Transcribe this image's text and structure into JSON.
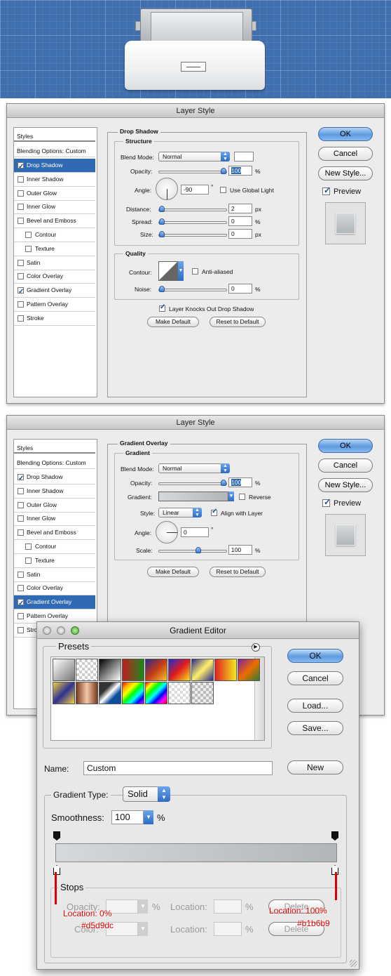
{
  "drop_shadow_dialog": {
    "title": "Layer Style",
    "styles_heading": "Styles",
    "blending_options": "Blending Options: Custom",
    "list": [
      {
        "label": "Drop Shadow",
        "checked": true,
        "selected": true
      },
      {
        "label": "Inner Shadow",
        "checked": false
      },
      {
        "label": "Outer Glow",
        "checked": false
      },
      {
        "label": "Inner Glow",
        "checked": false
      },
      {
        "label": "Bevel and Emboss",
        "checked": false
      },
      {
        "label": "Contour",
        "checked": false,
        "sub": true
      },
      {
        "label": "Texture",
        "checked": false,
        "sub": true
      },
      {
        "label": "Satin",
        "checked": false
      },
      {
        "label": "Color Overlay",
        "checked": false
      },
      {
        "label": "Gradient Overlay",
        "checked": true
      },
      {
        "label": "Pattern Overlay",
        "checked": false
      },
      {
        "label": "Stroke",
        "checked": false
      }
    ],
    "section_title": "Drop Shadow",
    "structure_title": "Structure",
    "blend_mode_label": "Blend Mode:",
    "blend_mode_value": "Normal",
    "opacity_label": "Opacity:",
    "opacity_value": "100",
    "angle_label": "Angle:",
    "angle_value": "-90",
    "degree": "°",
    "global_light_label": "Use Global Light",
    "distance_label": "Distance:",
    "distance_value": "2",
    "spread_label": "Spread:",
    "spread_value": "0",
    "size_label": "Size:",
    "size_value": "0",
    "quality_title": "Quality",
    "contour_label": "Contour:",
    "anti_aliased_label": "Anti-aliased",
    "noise_label": "Noise:",
    "noise_value": "0",
    "knocks_out_label": "Layer Knocks Out Drop Shadow",
    "make_default": "Make Default",
    "reset_default": "Reset to Default",
    "unit_pct": "%",
    "unit_px": "px",
    "ok": "OK",
    "cancel": "Cancel",
    "new_style": "New Style...",
    "preview": "Preview"
  },
  "gradient_overlay_dialog": {
    "title": "Layer Style",
    "styles_heading": "Styles",
    "blending_options": "Blending Options: Custom",
    "list": [
      {
        "label": "Drop Shadow",
        "checked": true
      },
      {
        "label": "Inner Shadow",
        "checked": false
      },
      {
        "label": "Outer Glow",
        "checked": false
      },
      {
        "label": "Inner Glow",
        "checked": false
      },
      {
        "label": "Bevel and Emboss",
        "checked": false
      },
      {
        "label": "Contour",
        "checked": false,
        "sub": true
      },
      {
        "label": "Texture",
        "checked": false,
        "sub": true
      },
      {
        "label": "Satin",
        "checked": false
      },
      {
        "label": "Color Overlay",
        "checked": false
      },
      {
        "label": "Gradient Overlay",
        "checked": true,
        "selected": true
      },
      {
        "label": "Pattern Overlay",
        "checked": false
      },
      {
        "label": "Stro",
        "checked": false
      }
    ],
    "section_title": "Gradient Overlay",
    "gradient_title": "Gradient",
    "blend_mode_label": "Blend Mode:",
    "blend_mode_value": "Normal",
    "opacity_label": "Opacity:",
    "opacity_value": "100",
    "gradient_label": "Gradient:",
    "reverse_label": "Reverse",
    "style_label": "Style:",
    "style_value": "Linear",
    "align_label": "Align with Layer",
    "angle_label": "Angle:",
    "angle_value": "0",
    "degree": "°",
    "scale_label": "Scale:",
    "scale_value": "100",
    "make_default": "Make Default",
    "reset_default": "Reset to Default",
    "unit_pct": "%",
    "ok": "OK",
    "cancel": "Cancel",
    "new_style": "New Style...",
    "preview": "Preview"
  },
  "gradient_editor": {
    "title": "Gradient Editor",
    "presets_label": "Presets",
    "ok": "OK",
    "cancel": "Cancel",
    "load": "Load...",
    "save": "Save...",
    "name_label": "Name:",
    "name_value": "Custom",
    "new": "New",
    "gradient_type_label": "Gradient Type:",
    "gradient_type_value": "Solid",
    "smoothness_label": "Smoothness:",
    "smoothness_value": "100",
    "unit_pct": "%",
    "stops_label": "Stops",
    "opacity_label": "Opacity:",
    "color_label": "Color:",
    "location_label": "Location:",
    "delete": "Delete",
    "annotation_left_location": "Location: 0%",
    "annotation_left_color": "#d5d9dc",
    "annotation_right_location": "Location: 100%",
    "annotation_right_color": "#b1b6b9",
    "gradient_colors": [
      "#d5d9dc",
      "#b1b6b9"
    ]
  }
}
